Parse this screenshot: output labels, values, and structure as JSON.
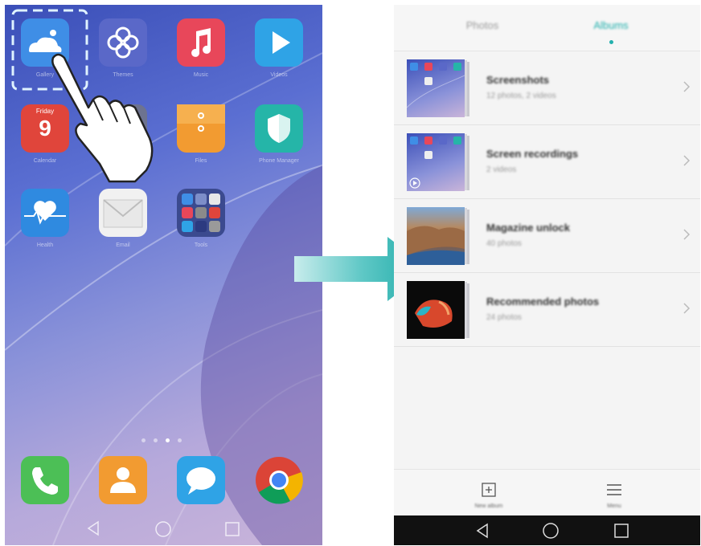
{
  "home_screen": {
    "apps": [
      {
        "name": "Gallery",
        "label": "Gallery",
        "color": "#3f8ee6"
      },
      {
        "name": "Themes",
        "label": "Themes",
        "color": "#5a68c8"
      },
      {
        "name": "Music",
        "label": "Music",
        "color": "#e8475a"
      },
      {
        "name": "Videos",
        "label": "Videos",
        "color": "#2fa3e6"
      },
      {
        "name": "Calendar",
        "label": "Calendar",
        "color": "#e0453b"
      },
      {
        "name": "Clock",
        "label": "",
        "color": "#777"
      },
      {
        "name": "Files",
        "label": "Files",
        "color": "#f29b31"
      },
      {
        "name": "Phone Manager",
        "label": "Phone Manager",
        "color": "#25b5a8"
      },
      {
        "name": "Health",
        "label": "Health",
        "color": "#2f8ae0"
      },
      {
        "name": "Email",
        "label": "Email",
        "color": "#f1f1f1"
      },
      {
        "name": "Tools",
        "label": "Tools",
        "color": "#3b4a8f"
      }
    ],
    "calendar": {
      "day": "Friday",
      "date": "9"
    },
    "dock": [
      "Phone",
      "Contacts",
      "Messaging",
      "Chrome"
    ],
    "page_indicator": {
      "pages": 4,
      "current": 3
    }
  },
  "gallery": {
    "tabs": [
      {
        "label": "Photos",
        "active": false
      },
      {
        "label": "Albums",
        "active": true
      }
    ],
    "accent_color": "#23b0ad",
    "albums": [
      {
        "title": "Screenshots",
        "subtitle": "12 photos, 2 videos"
      },
      {
        "title": "Screen recordings",
        "subtitle": "2 videos"
      },
      {
        "title": "Magazine unlock",
        "subtitle": "40 photos"
      },
      {
        "title": "Recommended photos",
        "subtitle": "24 photos"
      }
    ],
    "bottom_bar": {
      "new_album_label": "New album",
      "menu_label": "Menu"
    }
  }
}
